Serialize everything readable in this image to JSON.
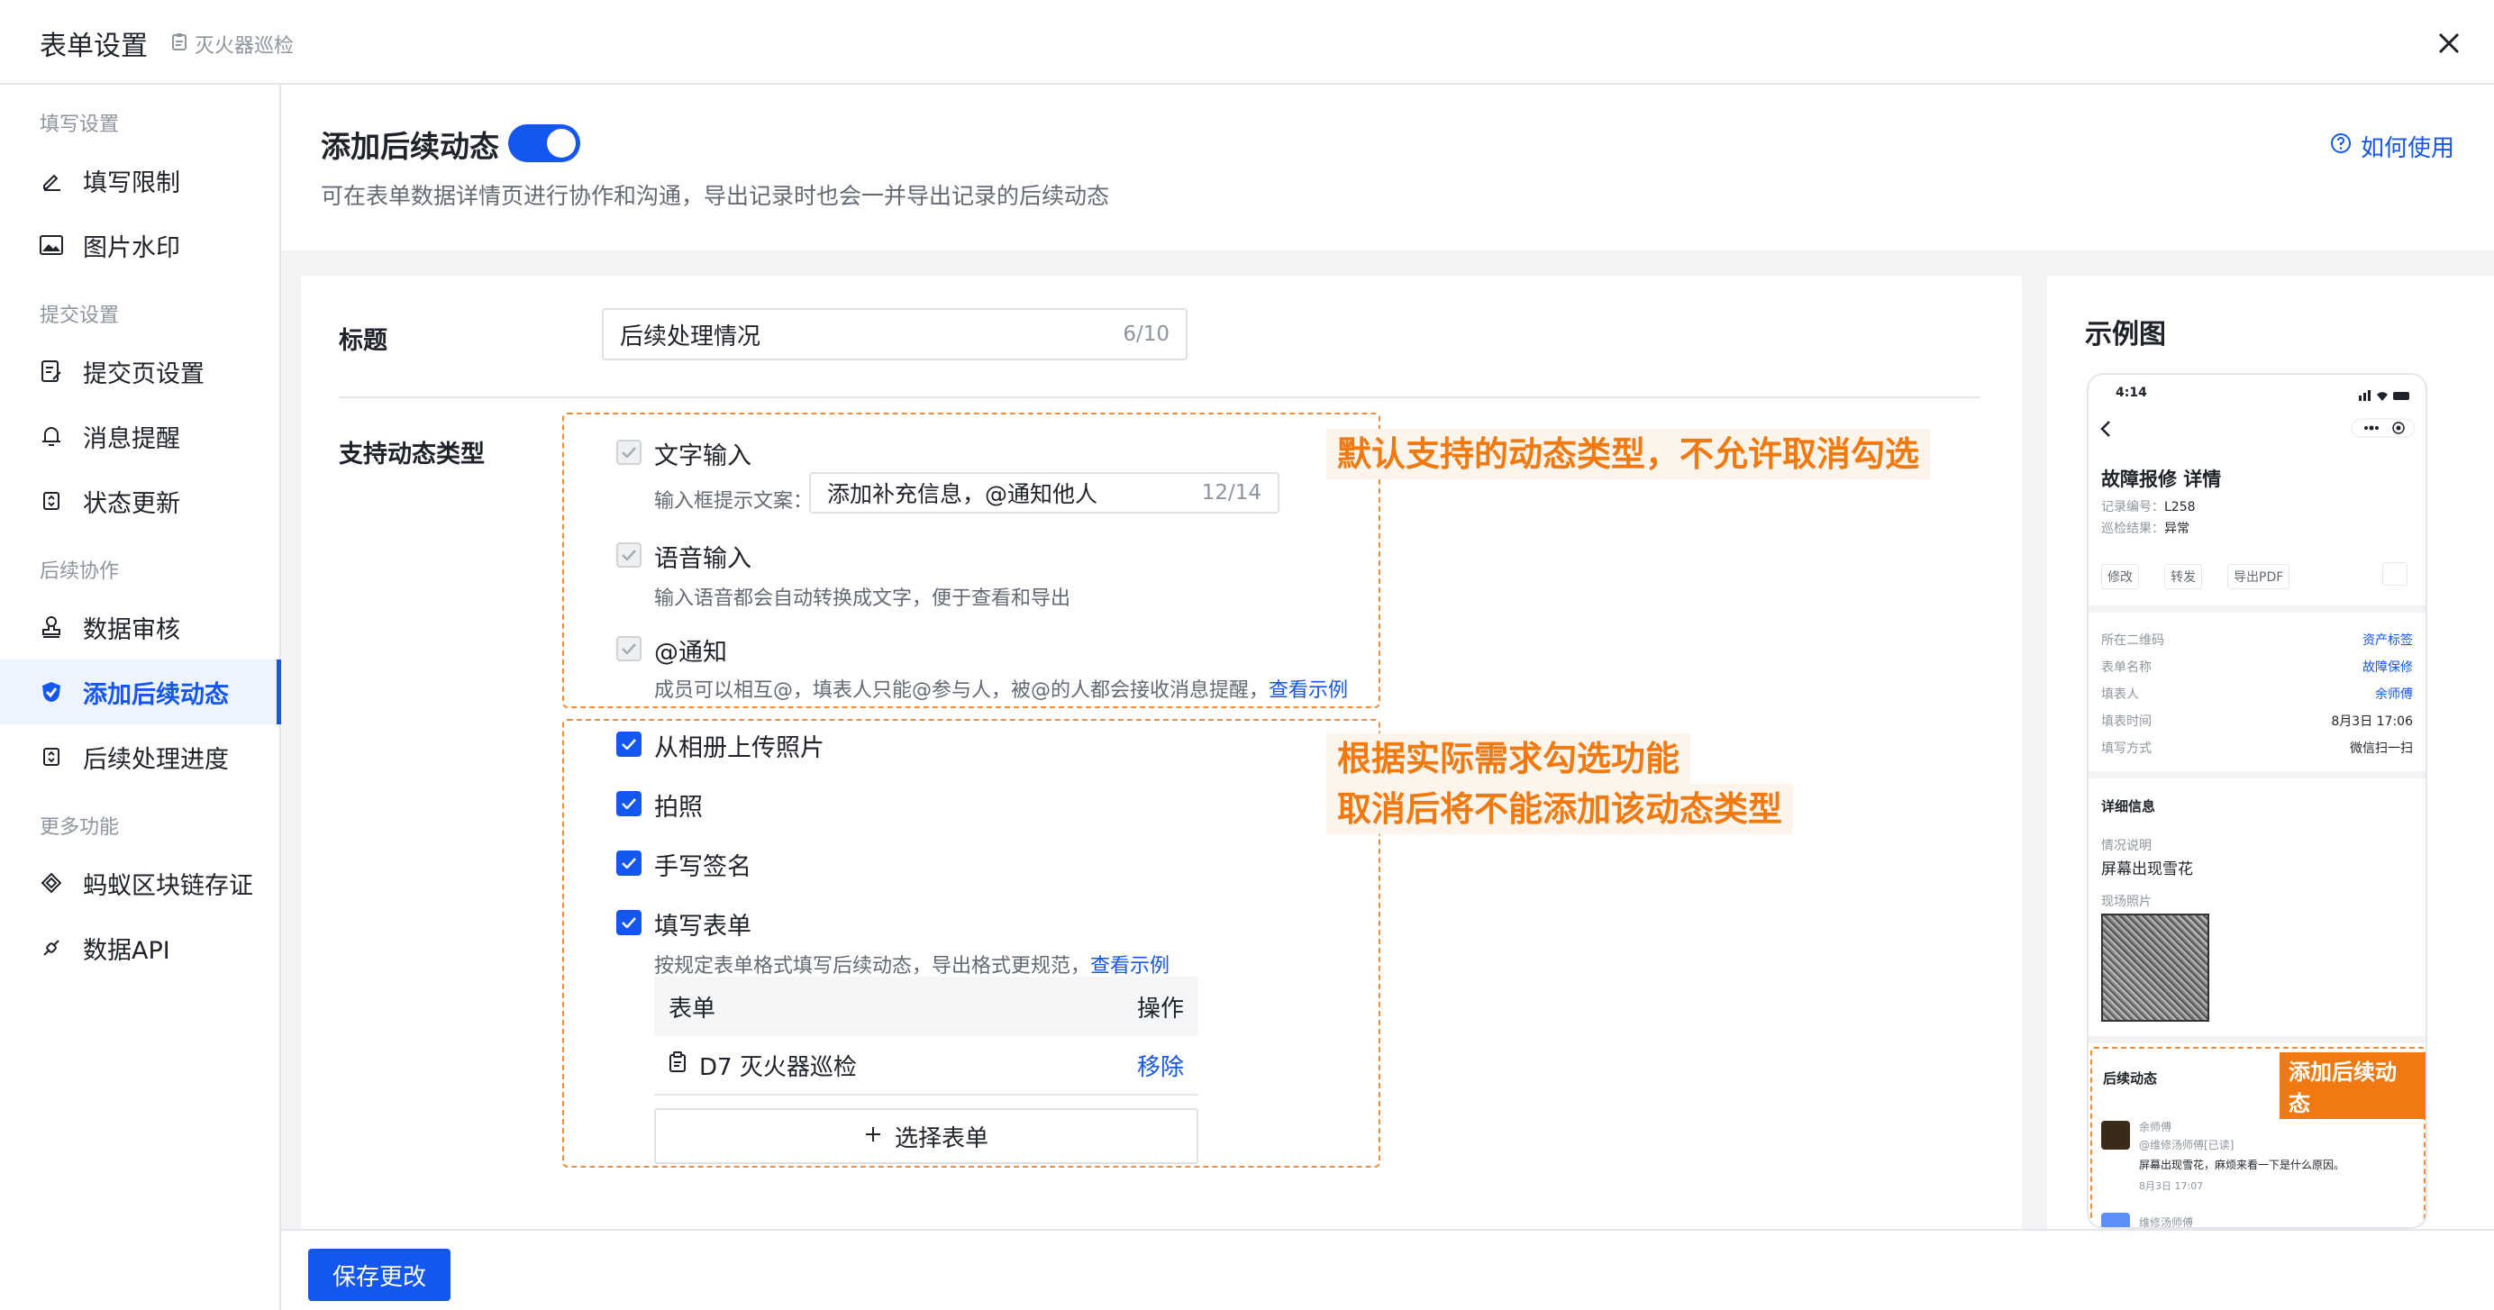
{
  "header": {
    "title": "表单设置",
    "subtitle": "灭火器巡检",
    "close_icon": "close-icon"
  },
  "sidebar": {
    "groups": [
      {
        "label": "填写设置",
        "items": [
          {
            "label": "填写限制",
            "icon": "pen-icon"
          },
          {
            "label": "图片水印",
            "icon": "image-icon"
          }
        ]
      },
      {
        "label": "提交设置",
        "items": [
          {
            "label": "提交页设置",
            "icon": "doc-edit-icon"
          },
          {
            "label": "消息提醒",
            "icon": "bell-icon"
          },
          {
            "label": "状态更新",
            "icon": "refresh-icon"
          }
        ]
      },
      {
        "label": "后续协作",
        "items": [
          {
            "label": "数据审核",
            "icon": "stamp-icon"
          },
          {
            "label": "添加后续动态",
            "icon": "shield-check-icon",
            "active": true
          },
          {
            "label": "后续处理进度",
            "icon": "refresh-icon"
          }
        ]
      },
      {
        "label": "更多功能",
        "items": [
          {
            "label": "蚂蚁区块链存证",
            "icon": "blockchain-icon"
          },
          {
            "label": "数据API",
            "icon": "api-icon"
          }
        ]
      }
    ]
  },
  "feature": {
    "title": "添加后续动态",
    "enabled": true,
    "description": "可在表单数据详情页进行协作和沟通，导出记录时也会一并导出记录的后续动态",
    "help_label": "如何使用"
  },
  "form": {
    "title_label": "标题",
    "title_value": "后续处理情况",
    "title_count": "6/10",
    "types_label": "支持动态类型",
    "default_types": [
      {
        "label": "文字输入",
        "hint_label": "输入框提示文案：",
        "hint_value": "添加补充信息，@通知他人",
        "hint_count": "12/14"
      },
      {
        "label": "语音输入",
        "desc": "输入语音都会自动转换成文字，便于查看和导出"
      },
      {
        "label": "@通知",
        "desc": "成员可以相互@，填表人只能@参与人，被@的人都会接收消息提醒，",
        "link": "查看示例"
      }
    ],
    "optional_types": [
      {
        "label": "从相册上传照片",
        "checked": true
      },
      {
        "label": "拍照",
        "checked": true
      },
      {
        "label": "手写签名",
        "checked": true
      },
      {
        "label": "填写表单",
        "checked": true,
        "desc": "按规定表单格式填写后续动态，导出格式更规范，",
        "link": "查看示例"
      }
    ],
    "table": {
      "col_form": "表单",
      "col_action": "操作",
      "rows": [
        {
          "name": "D7 灭火器巡检",
          "action": "移除"
        }
      ]
    },
    "select_form_label": "选择表单",
    "note_default": "默认支持的动态类型，不允许取消勾选",
    "note_optional_line1": "根据实际需求勾选功能",
    "note_optional_line2": "取消后将不能添加该动态类型",
    "accent": "#f07a11"
  },
  "preview": {
    "title": "示例图",
    "phone": {
      "time": "4:14",
      "record_title": "故障报修 详情",
      "record_no_label": "记录编号：",
      "record_no": "L258",
      "result_label": "巡检结果：",
      "result": "异常",
      "actions": [
        "修改",
        "转发",
        "导出PDF"
      ],
      "fields": [
        {
          "k": "所在二维码",
          "v": "资产标签",
          "link": true
        },
        {
          "k": "表单名称",
          "v": "故障保修",
          "link": true
        },
        {
          "k": "填表人",
          "v": "余师傅",
          "link": true
        },
        {
          "k": "填表时间",
          "v": "8月3日 17:06",
          "link": false
        },
        {
          "k": "填写方式",
          "v": "微信扫一扫",
          "link": false
        }
      ],
      "detail_title": "详细信息",
      "situation_label": "情况说明",
      "situation": "屏幕出现雪花",
      "photo_label": "现场照片",
      "followup_title": "后续动态",
      "followup_tag": "添加后续动态",
      "comment_user": "余师傅",
      "comment_mention": "@维修汤师傅[已读]",
      "comment_text": "屏幕出现雪花，麻烦来看一下是什么原因。",
      "comment_time": "8月3日 17:07",
      "next_user": "维修汤师傅"
    }
  },
  "footer": {
    "save_label": "保存更改"
  },
  "colors": {
    "primary": "#1456f0",
    "orange": "#f07a11",
    "bg": "#f2f3f5"
  }
}
